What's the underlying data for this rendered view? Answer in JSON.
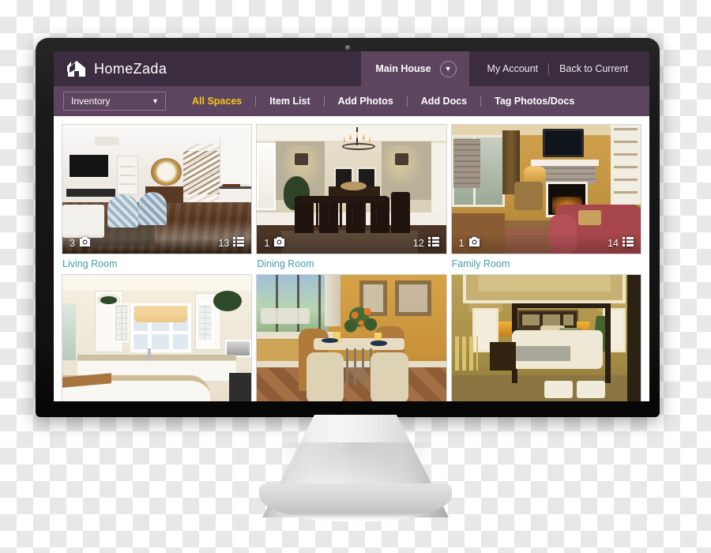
{
  "app": {
    "brand_name": "HomeZada",
    "brand_icon": "house-logo-icon"
  },
  "header": {
    "house_selector": {
      "label": "Main House",
      "chevron_icon": "chevron-down-icon"
    },
    "links": [
      {
        "label": "My Account"
      },
      {
        "label": "Back to Current"
      }
    ]
  },
  "nav": {
    "module_select": {
      "value": "Inventory",
      "chevron_icon": "chevron-down-icon"
    },
    "items": [
      {
        "label": "All Spaces",
        "active": true
      },
      {
        "label": "Item List",
        "active": false
      },
      {
        "label": "Add Photos",
        "active": false
      },
      {
        "label": "Add Docs",
        "active": false
      },
      {
        "label": "Tag Photos/Docs",
        "active": false
      }
    ]
  },
  "content": {
    "spaces": [
      {
        "title": "Living Room",
        "photo_count": "3",
        "item_count": "13",
        "photo_icon": "camera-icon",
        "item_icon": "list-icon",
        "scene": "living-room"
      },
      {
        "title": "Dining Room",
        "photo_count": "1",
        "item_count": "12",
        "photo_icon": "camera-icon",
        "item_icon": "list-icon",
        "scene": "dining-room"
      },
      {
        "title": "Family Room",
        "photo_count": "1",
        "item_count": "14",
        "photo_icon": "camera-icon",
        "item_icon": "list-icon",
        "scene": "family-room"
      },
      {
        "title": "",
        "photo_count": "",
        "item_count": "",
        "photo_icon": "",
        "item_icon": "",
        "scene": "kitchen"
      },
      {
        "title": "",
        "photo_count": "",
        "item_count": "",
        "photo_icon": "",
        "item_icon": "",
        "scene": "breakfast-nook"
      },
      {
        "title": "",
        "photo_count": "",
        "item_count": "",
        "photo_icon": "",
        "item_icon": "",
        "scene": "master-bedroom"
      }
    ]
  },
  "colors": {
    "header_purple": "#3b2c40",
    "nav_purple": "#5d4560",
    "active_nav": "#f5c518",
    "space_title": "#3f9fb0",
    "bezel_black": "#111111",
    "stand_silver": "#d6d6d6"
  }
}
